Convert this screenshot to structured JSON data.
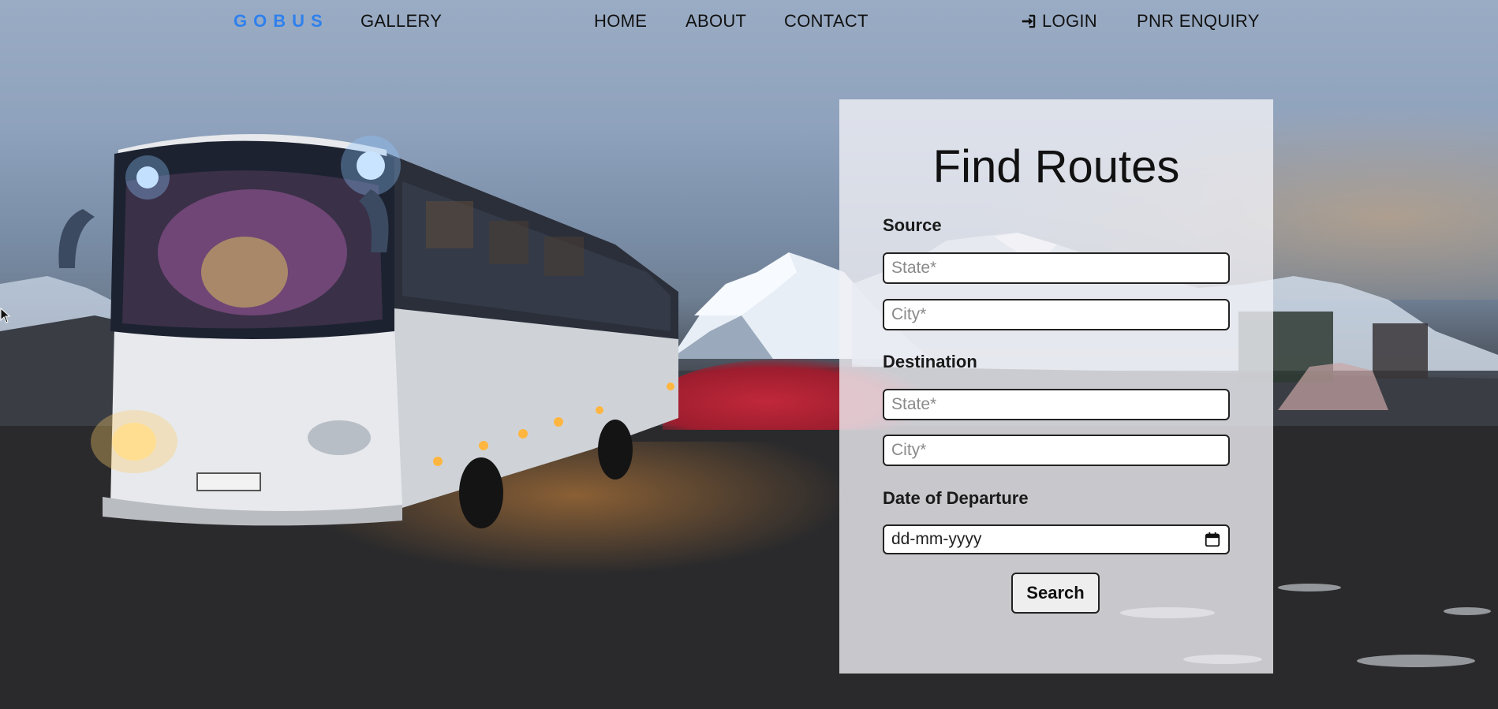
{
  "nav": {
    "brand": "GOBUS",
    "gallery": "GALLERY",
    "home": "HOME",
    "about": "ABOUT",
    "contact": "CONTACT",
    "login": "LOGIN",
    "login_icon": "sign-in-icon",
    "pnr": "PNR ENQUIRY"
  },
  "form": {
    "title": "Find Routes",
    "source_label": "Source",
    "source_state_placeholder": "State*",
    "source_city_placeholder": "City*",
    "destination_label": "Destination",
    "destination_state_placeholder": "State*",
    "destination_city_placeholder": "City*",
    "date_label": "Date of Departure",
    "date_placeholder": "dd-mm-yyyy",
    "date_icon": "calendar-icon",
    "search_button": "Search"
  },
  "colors": {
    "brand": "#2f80ed",
    "panel_background": "rgba(240,240,245,0.80)",
    "text": "#111111"
  }
}
